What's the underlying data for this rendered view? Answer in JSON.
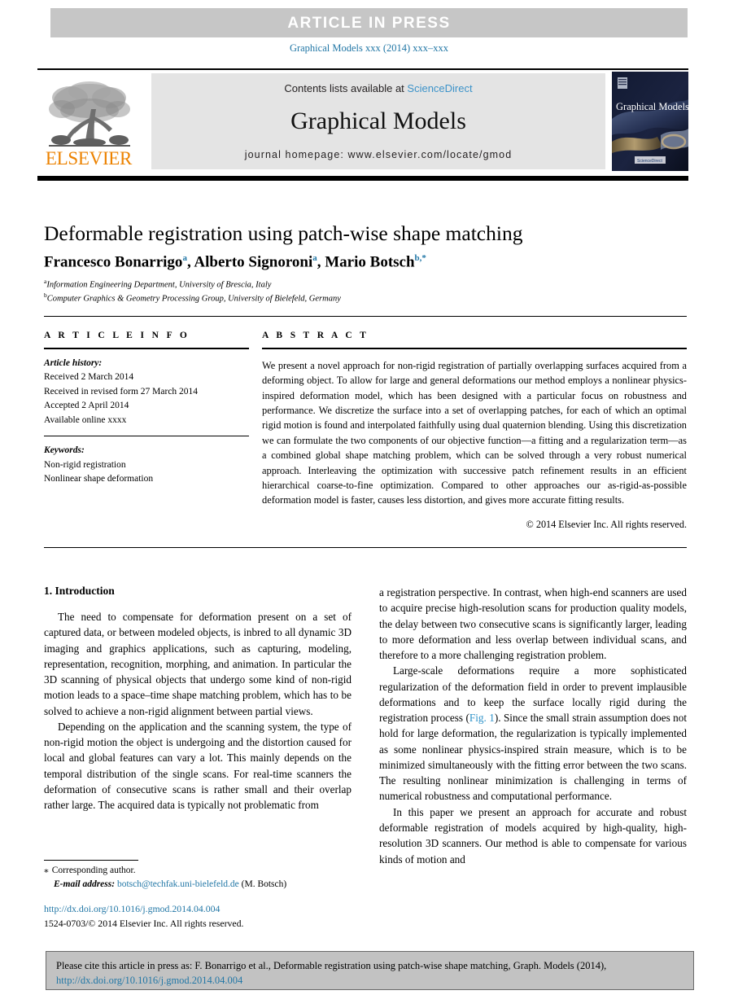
{
  "banner": {
    "article_in_press": "ARTICLE  IN  PRESS",
    "journal_reference": "Graphical Models xxx (2014) xxx–xxx"
  },
  "masthead": {
    "publisher_name": "ELSEVIER",
    "contents_prefix": "Contents lists available at ",
    "sciencedirect": "ScienceDirect",
    "journal_name": "Graphical Models",
    "homepage": "journal homepage: www.elsevier.com/locate/gmod",
    "cover_title": "Graphical Models",
    "cover_footer": "ScienceDirect"
  },
  "article": {
    "title": "Deformable registration using patch-wise shape matching",
    "authors": [
      {
        "name": "Francesco Bonarrigo",
        "mark": "a",
        "sep": ", "
      },
      {
        "name": "Alberto Signoroni",
        "mark": "a",
        "sep": ", "
      },
      {
        "name": "Mario Botsch",
        "mark": "b,*",
        "sep": ""
      }
    ],
    "affiliations": [
      {
        "mark": "a",
        "text": "Information Engineering Department, University of Brescia, Italy"
      },
      {
        "mark": "b",
        "text": "Computer Graphics & Geometry Processing Group, University of Bielefeld, Germany"
      }
    ]
  },
  "info": {
    "heading": "A R T I C L E   I N F O",
    "history_label": "Article history:",
    "history": [
      "Received 2 March 2014",
      "Received in revised form 27 March 2014",
      "Accepted 2 April 2014",
      "Available online xxxx"
    ],
    "keywords_label": "Keywords:",
    "keywords": [
      "Non-rigid registration",
      "Nonlinear shape deformation"
    ]
  },
  "abstract": {
    "heading": "A B S T R A C T",
    "text": "We present a novel approach for non-rigid registration of partially overlapping surfaces acquired from a deforming object. To allow for large and general deformations our method employs a nonlinear physics-inspired deformation model, which has been designed with a particular focus on robustness and performance. We discretize the surface into a set of overlapping patches, for each of which an optimal rigid motion is found and interpolated faithfully using dual quaternion blending. Using this discretization we can formulate the two components of our objective function—a fitting and a regularization term—as a combined global shape matching problem, which can be solved through a very robust numerical approach. Interleaving the optimization with successive patch refinement results in an efficient hierarchical coarse-to-fine optimization. Compared to other approaches our as-rigid-as-possible deformation model is faster, causes less distortion, and gives more accurate fitting results.",
    "copyright": "© 2014 Elsevier Inc. All rights reserved."
  },
  "body": {
    "section_title": "1. Introduction",
    "left_paragraphs": [
      "The need to compensate for deformation present on a set of captured data, or between modeled objects, is inbred to all dynamic 3D imaging and graphics applications, such as capturing, modeling, representation, recognition, morphing, and animation. In particular the 3D scanning of physical objects that undergo some kind of non-rigid motion leads to a space–time shape matching problem, which has to be solved to achieve a non-rigid alignment between partial views.",
      "Depending on the application and the scanning system, the type of non-rigid motion the object is undergoing and the distortion caused for local and global features can vary a lot. This mainly depends on the temporal distribution of the single scans. For real-time scanners the deformation of consecutive scans is rather small and their overlap rather large. The acquired data is typically not problematic from"
    ],
    "right_paragraphs": [
      {
        "pre": "a registration perspective. In contrast, when high-end scanners are used to acquire precise high-resolution scans for production quality models, the delay between two consecutive scans is significantly larger, leading to more deformation and less overlap between individual scans, and therefore to a more challenging registration problem.",
        "link": "",
        "post": "",
        "indent": false
      },
      {
        "pre": "Large-scale deformations require a more sophisticated regularization of the deformation field in order to prevent implausible deformations and to keep the surface locally rigid during the registration process (",
        "link": "Fig. 1",
        "post": "). Since the small strain assumption does not hold for large deformation, the regularization is typically implemented as some nonlinear physics-inspired strain measure, which is to be minimized simultaneously with the fitting error between the two scans. The resulting nonlinear minimization is challenging in terms of numerical robustness and computational performance.",
        "indent": true
      },
      {
        "pre": "In this paper we present an approach for accurate and robust deformable registration of models acquired by high-quality, high-resolution 3D scanners. Our method is able to compensate for various kinds of motion and",
        "link": "",
        "post": "",
        "indent": true
      }
    ]
  },
  "footnote": {
    "star": "⁎",
    "corresponding": "Corresponding author.",
    "email_label": "E-mail address:",
    "email": "botsch@techfak.uni-bielefeld.de",
    "email_owner": "(M. Botsch)",
    "doi_url": "http://dx.doi.org/10.1016/j.gmod.2014.04.004",
    "issn_line": "1524-0703/© 2014 Elsevier Inc. All rights reserved."
  },
  "citation": {
    "text": "Please cite this article in press as: F. Bonarrigo et al., Deformable registration using patch-wise shape matching, Graph. Models (2014),",
    "url": "http://dx.doi.org/10.1016/j.gmod.2014.04.004"
  },
  "colors": {
    "link_blue": "#2277a6",
    "sciencedirect_blue": "#3d93c9",
    "elsevier_orange": "#ec8200",
    "banner_gray": "#c6c6c6",
    "masthead_gray": "#e4e4e4",
    "citation_gray": "#c2c2c2"
  }
}
